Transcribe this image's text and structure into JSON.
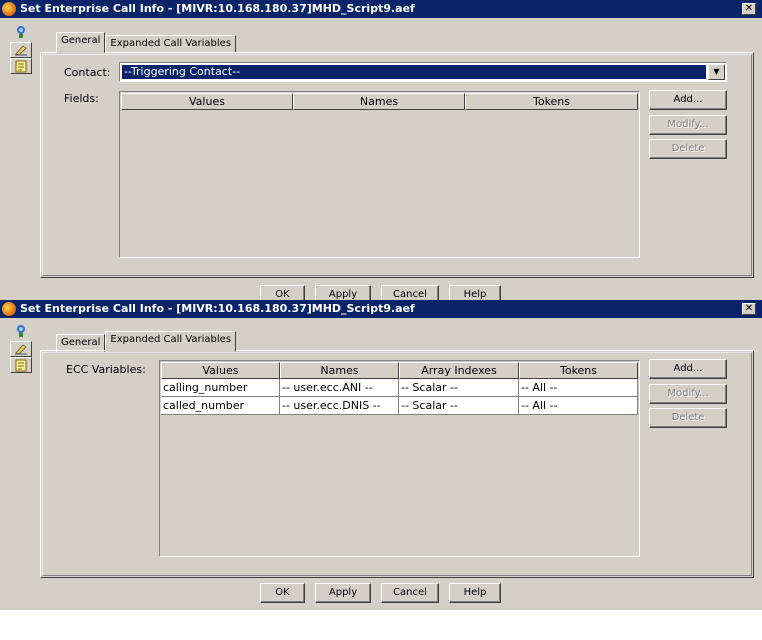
{
  "top": {
    "title": "Set Enterprise Call Info - [MIVR:10.168.180.37]MHD_Script9.aef",
    "close_glyph": "✕",
    "tabs": [
      {
        "label": "General",
        "active": true
      },
      {
        "label": "Expanded Call Variables",
        "active": false
      }
    ],
    "contact_label": "Contact:",
    "contact_value": "--Triggering Contact--",
    "fields_label": "Fields:",
    "columns": [
      "Values",
      "Names",
      "Tokens"
    ],
    "buttons": {
      "add": "Add...",
      "modify": "Modify...",
      "delete": "Delete"
    },
    "bottom_buttons": {
      "ok": "OK",
      "apply": "Apply",
      "cancel": "Cancel",
      "help": "Help"
    }
  },
  "bottom": {
    "title": "Set Enterprise Call Info - [MIVR:10.168.180.37]MHD_Script9.aef",
    "close_glyph": "✕",
    "tabs": [
      {
        "label": "General",
        "active": false
      },
      {
        "label": "Expanded Call Variables",
        "active": true
      }
    ],
    "ecc_label": "ECC Variables:",
    "columns": [
      "Values",
      "Names",
      "Array Indexes",
      "Tokens"
    ],
    "rows": [
      [
        "calling_number",
        "-- user.ecc.ANI --",
        "-- Scalar --",
        "-- All --"
      ],
      [
        "called_number",
        "-- user.ecc.DNIS --",
        "-- Scalar --",
        "-- All --"
      ]
    ],
    "buttons": {
      "add": "Add...",
      "modify": "Modify...",
      "delete": "Delete"
    },
    "bottom_buttons": {
      "ok": "OK",
      "apply": "Apply",
      "cancel": "Cancel",
      "help": "Help"
    }
  },
  "sidebar_icons": [
    "designer-icon",
    "edit-icon",
    "notes-icon"
  ],
  "colors": {
    "titlebar": "#0a246a",
    "face": "#d4d0c8",
    "selection": "#0a246a"
  }
}
